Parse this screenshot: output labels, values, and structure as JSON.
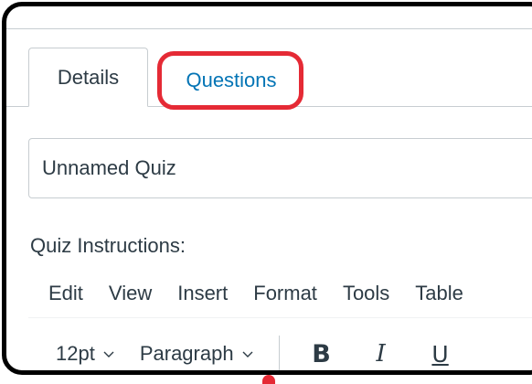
{
  "tabs": {
    "details_label": "Details",
    "questions_label": "Questions"
  },
  "quiz": {
    "title_value": "Unnamed Quiz"
  },
  "instructions": {
    "label": "Quiz Instructions:"
  },
  "menubar": {
    "edit": "Edit",
    "view": "View",
    "insert": "Insert",
    "format": "Format",
    "tools": "Tools",
    "table": "Table"
  },
  "toolbar": {
    "font_size": "12pt",
    "block_format": "Paragraph",
    "bold_glyph": "B",
    "italic_glyph": "I",
    "underline_glyph": "U"
  },
  "colors": {
    "link": "#0374b5",
    "text": "#2d3b45",
    "highlight": "#e52a35",
    "border": "#c7cdd1",
    "frame": "#000000"
  },
  "icons": [
    "chevron-down-icon",
    "bold-icon",
    "italic-icon",
    "underline-icon"
  ]
}
